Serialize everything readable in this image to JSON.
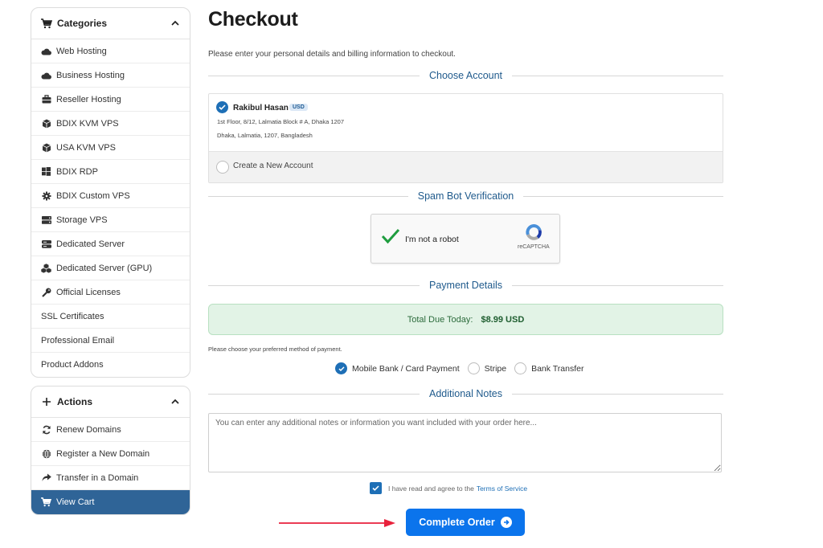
{
  "sidebar": {
    "categories": {
      "title": "Categories",
      "items": [
        {
          "label": "Web Hosting",
          "icon": "cloud-icon"
        },
        {
          "label": "Business Hosting",
          "icon": "cloud-icon"
        },
        {
          "label": "Reseller Hosting",
          "icon": "briefcase-icon"
        },
        {
          "label": "BDIX KVM VPS",
          "icon": "cube-icon"
        },
        {
          "label": "USA KVM VPS",
          "icon": "cube-icon"
        },
        {
          "label": "BDIX RDP",
          "icon": "windows-icon"
        },
        {
          "label": "BDIX Custom VPS",
          "icon": "gear-icon"
        },
        {
          "label": "Storage VPS",
          "icon": "server-icon"
        },
        {
          "label": "Dedicated Server",
          "icon": "server-stack-icon"
        },
        {
          "label": "Dedicated Server (GPU)",
          "icon": "cubes-icon"
        },
        {
          "label": "Official Licenses",
          "icon": "key-icon"
        },
        {
          "label": "SSL Certificates",
          "icon": ""
        },
        {
          "label": "Professional Email",
          "icon": ""
        },
        {
          "label": "Product Addons",
          "icon": ""
        }
      ]
    },
    "actions": {
      "title": "Actions",
      "items": [
        {
          "label": "Renew Domains",
          "icon": "refresh-icon"
        },
        {
          "label": "Register a New Domain",
          "icon": "globe-icon"
        },
        {
          "label": "Transfer in a Domain",
          "icon": "share-arrow-icon"
        },
        {
          "label": "View Cart",
          "icon": "cart-icon"
        }
      ]
    }
  },
  "main": {
    "title": "Checkout",
    "intro": "Please enter your personal details and billing information to checkout.",
    "sections": {
      "account": "Choose Account",
      "spam": "Spam Bot Verification",
      "payment": "Payment Details",
      "notes": "Additional Notes"
    },
    "account": {
      "name": "Rakibul Hasan",
      "currency_badge": "USD",
      "address1": "1st Floor, 8/12, Lalmatia Block # A, Dhaka 1207",
      "address2": "Dhaka, Lalmatia, 1207, Bangladesh",
      "create_new": "Create a New Account"
    },
    "captcha": {
      "label": "I'm not a robot",
      "brand": "reCAPTCHA"
    },
    "payment": {
      "total_label": "Total Due Today:",
      "total_amount": "$8.99 USD",
      "note": "Please choose your preferred method of payment.",
      "methods": [
        {
          "label": "Mobile Bank / Card Payment",
          "selected": true
        },
        {
          "label": "Stripe",
          "selected": false
        },
        {
          "label": "Bank Transfer",
          "selected": false
        }
      ]
    },
    "notes": {
      "placeholder": "You can enter any additional notes or information you want included with your order here..."
    },
    "tos": {
      "prefix": "I have read and agree to the",
      "link": "Terms of Service"
    },
    "complete_button": "Complete Order"
  },
  "colors": {
    "accent": "#1e6fb6",
    "button": "#0b74ec",
    "sidebar_active": "#2f6497",
    "section_title": "#1f5a8c",
    "total_bg": "#e2f3e6",
    "pointer_arrow": "#e8213b"
  }
}
